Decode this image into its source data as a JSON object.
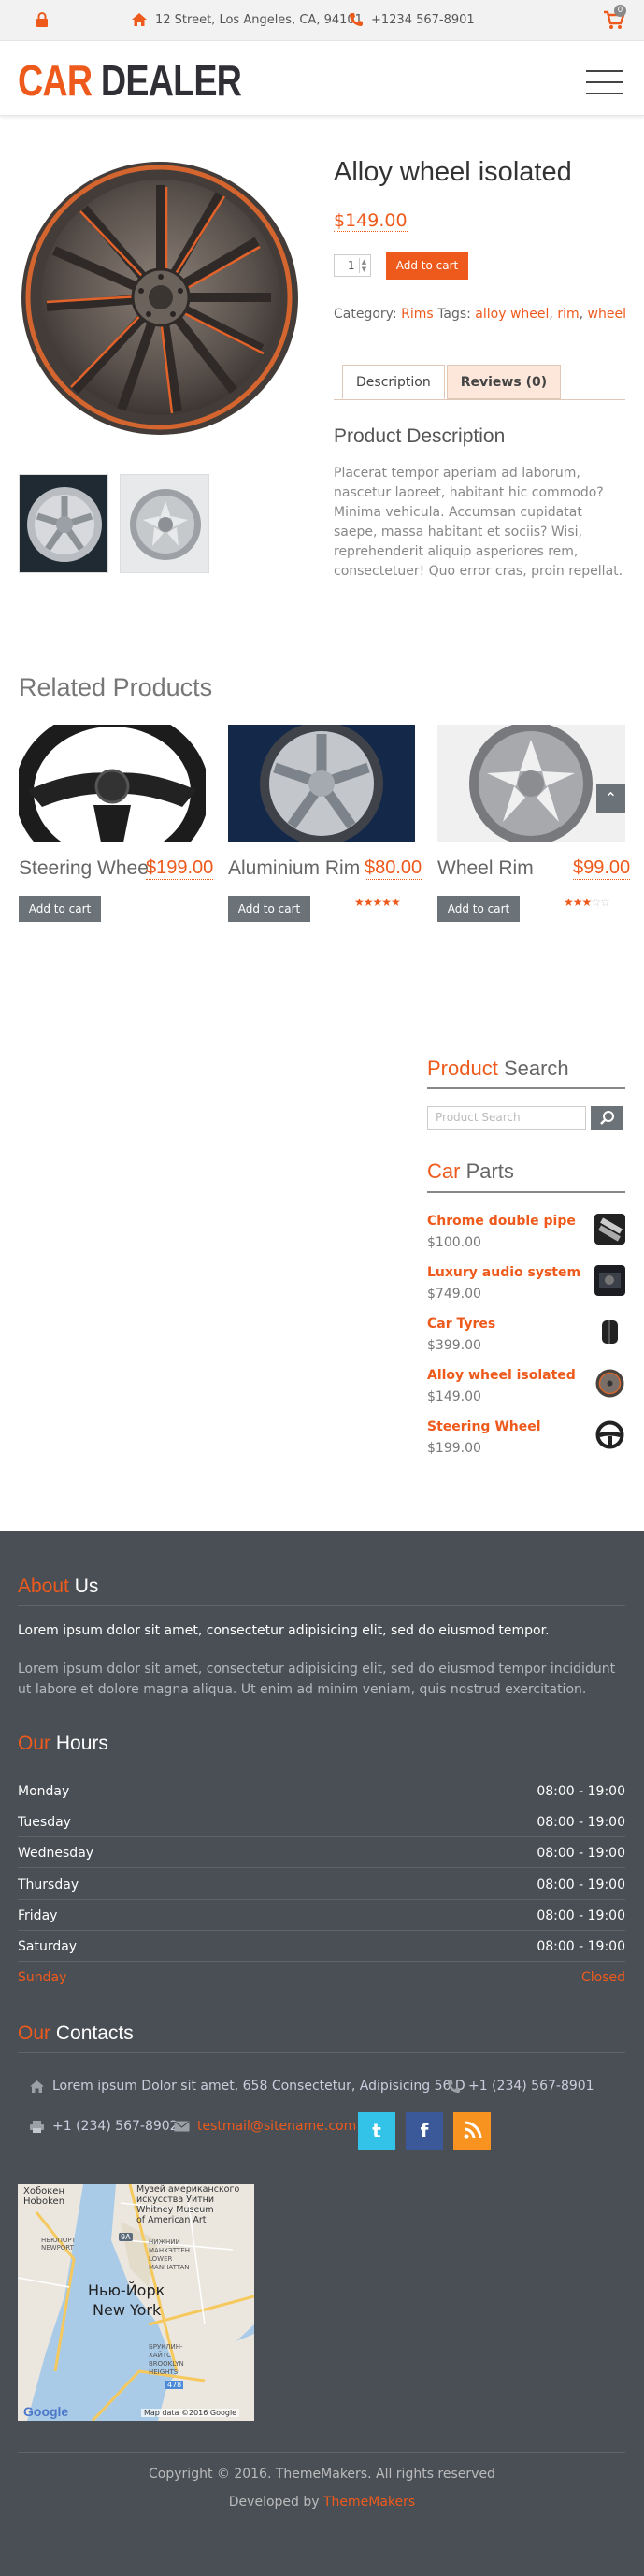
{
  "topbar": {
    "address": "12 Street, Los Angeles, CA, 94101",
    "phone": "+1234 567-8901",
    "cart_count": "0"
  },
  "header": {
    "logo_part1": "CAR",
    "logo_part2": "DEALER"
  },
  "product": {
    "title": "Alloy wheel isolated",
    "price": "$149.00",
    "quantity": "1",
    "add_to_cart": "Add to cart",
    "category_label": "Category:",
    "category": "Rims",
    "tags_label": "Tags:",
    "tags": [
      "alloy wheel",
      "rim",
      "wheel"
    ],
    "tabs": [
      "Description",
      "Reviews (0)"
    ],
    "description_title": "Product Description",
    "description": "Placerat tempor aperiam ad laborum, nascetur laoreet, habitant hic commodo? Minima vehicula. Accumsan cupidatat saepe, massa habitant et sociis? Wisi, reprehenderit aliquip asperiores rem, consectetuer! Quo error cras, proin repellat."
  },
  "related": {
    "title": "Related Products",
    "items": [
      {
        "name": "Steering Wheel",
        "price": "$199.00",
        "button": "Add to cart",
        "rating": 0
      },
      {
        "name": "Aluminium Rim",
        "price": "$80.00",
        "button": "Add to cart",
        "rating": 5
      },
      {
        "name": "Wheel Rim",
        "price": "$99.00",
        "button": "Add to cart",
        "rating": 3
      }
    ]
  },
  "sidebar": {
    "search_title_1": "Product",
    "search_title_2": " Search",
    "search_placeholder": "Product Search",
    "parts_title_1": "Car",
    "parts_title_2": " Parts",
    "parts": [
      {
        "name": "Chrome double pipe",
        "price": "$100.00"
      },
      {
        "name": "Luxury audio system",
        "price": "$749.00"
      },
      {
        "name": "Car Tyres",
        "price": "$399.00"
      },
      {
        "name": "Alloy wheel isolated",
        "price": "$149.00"
      },
      {
        "name": "Steering Wheel",
        "price": "$199.00"
      }
    ]
  },
  "footer": {
    "about_title_1": "About",
    "about_title_2": " Us",
    "about_lead": "Lorem ipsum dolor sit amet, consectetur adipisicing elit, sed do eiusmod tempor.",
    "about_text": "Lorem ipsum dolor sit amet, consectetur adipisicing elit, sed do eiusmod tempor incididunt ut labore et dolore magna aliqua. Ut enim ad minim veniam, quis nostrud exercitation.",
    "hours_title_1": "Our",
    "hours_title_2": " Hours",
    "hours": [
      {
        "day": "Monday",
        "time": "08:00 - 19:00"
      },
      {
        "day": "Tuesday",
        "time": "08:00 - 19:00"
      },
      {
        "day": "Wednesday",
        "time": "08:00 - 19:00"
      },
      {
        "day": "Thursday",
        "time": "08:00 - 19:00"
      },
      {
        "day": "Friday",
        "time": "08:00 - 19:00"
      },
      {
        "day": "Saturday",
        "time": "08:00 - 19:00"
      },
      {
        "day": "Sunday",
        "time": "Closed"
      }
    ],
    "contacts_title_1": "Our",
    "contacts_title_2": " Contacts",
    "address": "Lorem ipsum Dolor sit amet, 658 Consectetur, Adipisicing 56 D",
    "phone": "+1 (234) 567-8901",
    "fax": "+1 (234) 567-8902",
    "email": "testmail@sitename.com",
    "map_labels": {
      "hoboken": "Хобокен\nHoboken",
      "museum": "Музей американского\nискусства Уитни\nWhitney Museum\nof American Art",
      "newport": "НЬЮПОРТ\nNEWPORT",
      "tribeca": "НИЖНИЙ\nМАНХЭТТЕН\nLOWER\nMANHATTAN",
      "ny_ru": "Нью-Йорк",
      "ny_en": "New York",
      "brooklyn": "БРУКЛИН-\nХАЙТС\nBROOKLYN\nHEIGHTS",
      "google": "Google",
      "credit": "Map data ©2016 Google",
      "road": "478",
      "road2": "9A"
    },
    "copyright": "Copyright © 2016. ThemeMakers. All rights reserved",
    "developed_by": "Developed by",
    "developer": "ThemeMakers"
  },
  "colors": {
    "accent": "#ee5a1c",
    "footer_bg": "#4a4f55",
    "button_grey": "#6c7378",
    "twitter": "#33c3e8",
    "facebook": "#3b5998",
    "rss": "#f7931e"
  }
}
